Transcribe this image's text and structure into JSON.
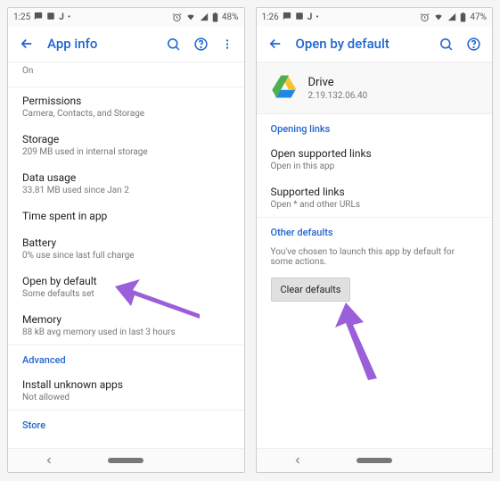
{
  "left": {
    "status": {
      "time": "1:25",
      "battery": "48%"
    },
    "appbar": {
      "title": "App info"
    },
    "rows": {
      "on": {
        "primary": "On"
      },
      "permissions": {
        "primary": "Permissions",
        "secondary": "Camera, Contacts, and Storage"
      },
      "storage": {
        "primary": "Storage",
        "secondary": "209 MB used in internal storage"
      },
      "datausage": {
        "primary": "Data usage",
        "secondary": "33.81 MB used since Jan 2"
      },
      "time_in_app": {
        "primary": "Time spent in app"
      },
      "battery": {
        "primary": "Battery",
        "secondary": "0% use since last full charge"
      },
      "open_default": {
        "primary": "Open by default",
        "secondary": "Some defaults set"
      },
      "memory": {
        "primary": "Memory",
        "secondary": "88 kB avg memory used in last 3 hours"
      },
      "advanced": {
        "label": "Advanced"
      },
      "install_unknown": {
        "primary": "Install unknown apps",
        "secondary": "Not allowed"
      },
      "store": {
        "label": "Store"
      }
    }
  },
  "right": {
    "status": {
      "time": "1:26",
      "battery": "47%"
    },
    "appbar": {
      "title": "Open by default"
    },
    "app": {
      "name": "Drive",
      "version": "2.19.132.06.40"
    },
    "sections": {
      "opening_links": "Opening links",
      "other_defaults": "Other defaults"
    },
    "rows": {
      "open_supported": {
        "primary": "Open supported links",
        "secondary": "Open in this app"
      },
      "supported": {
        "primary": "Supported links",
        "secondary": "Open * and other URLs"
      }
    },
    "note": "You've chosen to launch this app by default for some actions.",
    "button": {
      "clear_defaults": "Clear defaults"
    }
  }
}
